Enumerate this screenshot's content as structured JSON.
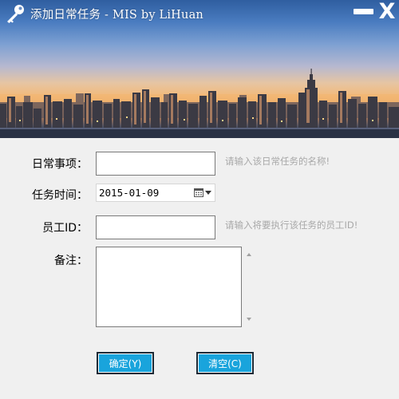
{
  "window": {
    "title": "添加日常任务 - MIS by LiHuan",
    "key_icon": "key-icon",
    "minimize_icon": "minimize-icon",
    "close_label": "X"
  },
  "form": {
    "task_name": {
      "label": "日常事项：",
      "value": "",
      "hint": "请输入该日常任务的名称!"
    },
    "task_time": {
      "label": "任务时间：",
      "value": "2015-01-09",
      "icons": [
        "calendar-icon",
        "dropdown-arrow-icon"
      ]
    },
    "employee_id": {
      "label": "员工ID：",
      "value": "",
      "hint": "请输入将要执行该任务的员工ID!"
    },
    "remark": {
      "label": "备注：",
      "value": ""
    }
  },
  "buttons": {
    "confirm": "确定(Y)",
    "clear": "清空(C)"
  },
  "colors": {
    "button_fill": "#19a4dc",
    "hint_text": "#a8a8a8",
    "background": "#f0f0f0"
  }
}
